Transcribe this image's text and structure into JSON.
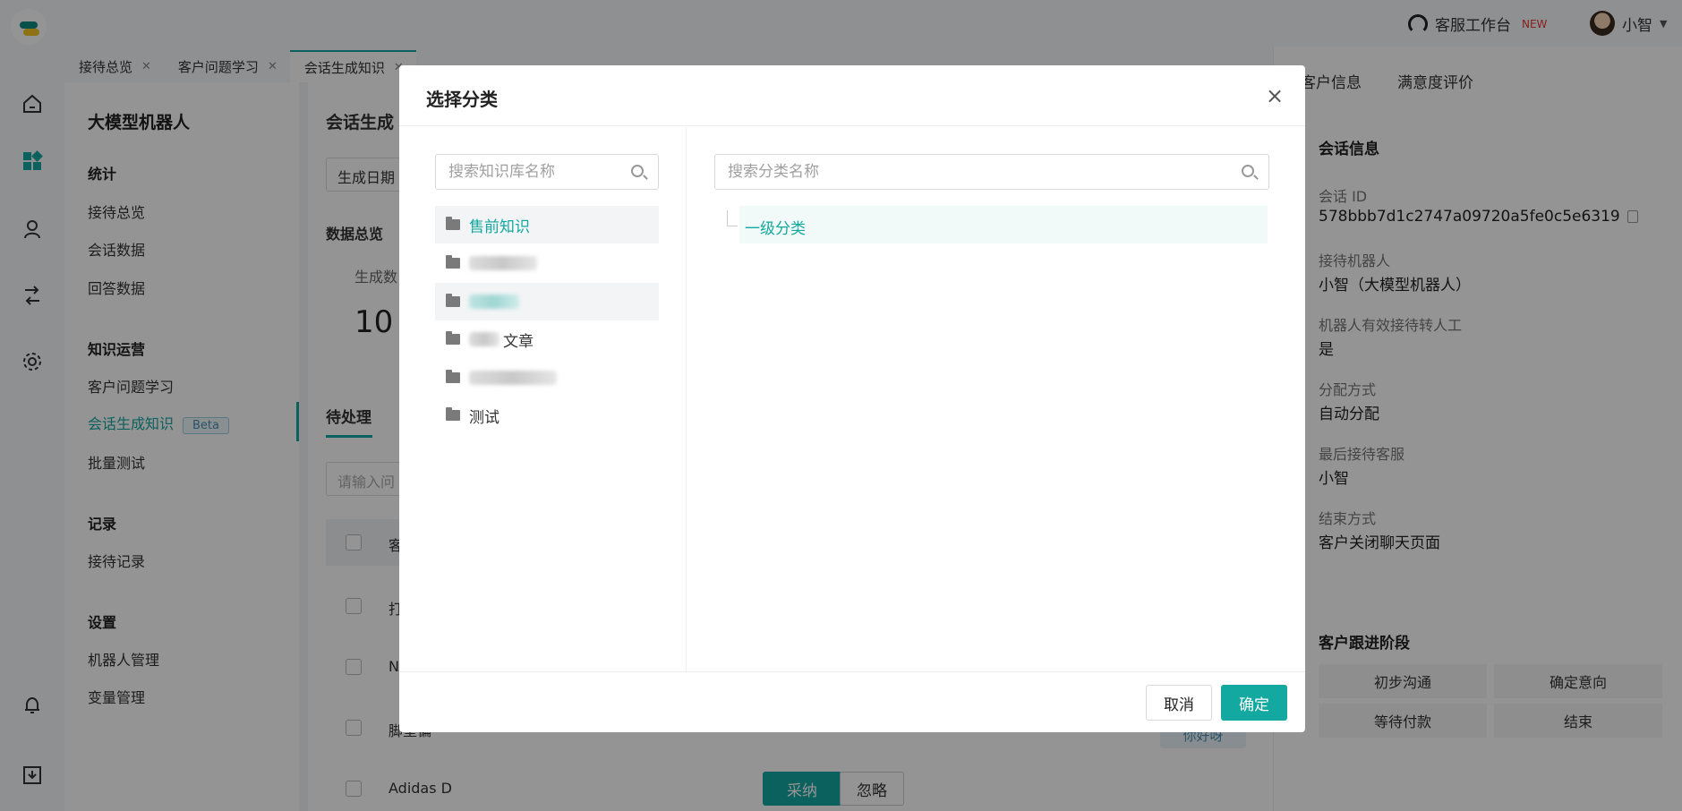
{
  "app": {
    "workbench_label": "客服工作台",
    "new_badge": "NEW",
    "user_name": "小智"
  },
  "tabs": [
    {
      "label": "接待总览"
    },
    {
      "label": "客户问题学习"
    },
    {
      "label": "会话生成知识"
    }
  ],
  "menu": {
    "title": "大模型机器人",
    "groups": [
      {
        "label": "统计",
        "items": [
          "接待总览",
          "会话数据",
          "回答数据"
        ]
      },
      {
        "label": "知识运营",
        "items": [
          "客户问题学习",
          "会话生成知识",
          "批量测试"
        ]
      },
      {
        "label": "记录",
        "items": [
          "接待记录"
        ]
      },
      {
        "label": "设置",
        "items": [
          "机器人管理",
          "变量管理"
        ]
      }
    ],
    "beta": "Beta"
  },
  "main": {
    "title": "会话生成",
    "date_select": "生成日期",
    "overview": "数据总览",
    "generated_label": "生成数",
    "generated_value": "10",
    "pending_tab": "待处理",
    "query_placeholder": "请输入问",
    "header_first": "客",
    "rows": [
      "打",
      "N",
      "脚垫偏",
      "Adidas D"
    ],
    "chip_hello": "你好呀",
    "adopt": "采纳",
    "ignore": "忽略"
  },
  "right": {
    "tabs": [
      "客户信息",
      "满意度评价"
    ],
    "session_title": "会话信息",
    "fields": [
      {
        "label": "会话 ID",
        "value": "578bbb7d1c2747a09720a5fe0c5e6319"
      },
      {
        "label": "接待机器人",
        "value": "小智（大模型机器人）"
      },
      {
        "label": "机器人有效接待转人工",
        "value": "是"
      },
      {
        "label": "分配方式",
        "value": "自动分配"
      },
      {
        "label": "最后接待客服",
        "value": "小智"
      },
      {
        "label": "结束方式",
        "value": "客户关闭聊天页面"
      }
    ],
    "stage_title": "客户跟进阶段",
    "stages": [
      "初步沟通",
      "确定意向",
      "等待付款",
      "结束"
    ]
  },
  "modal": {
    "title": "选择分类",
    "lib_search_placeholder": "搜索知识库名称",
    "cat_search_placeholder": "搜索分类名称",
    "libraries": [
      {
        "label": "售前知识",
        "selected": true
      },
      {
        "label": "",
        "redacted": true
      },
      {
        "label": "",
        "redacted": true
      },
      {
        "label": "文章",
        "redacted": true
      },
      {
        "label": "",
        "redacted": true
      },
      {
        "label": "测试"
      }
    ],
    "category": "一级分类",
    "cancel": "取消",
    "confirm": "确定"
  },
  "colors": {
    "accent": "#13a8a0",
    "overlay": "rgba(0,0,0,0.42)"
  }
}
